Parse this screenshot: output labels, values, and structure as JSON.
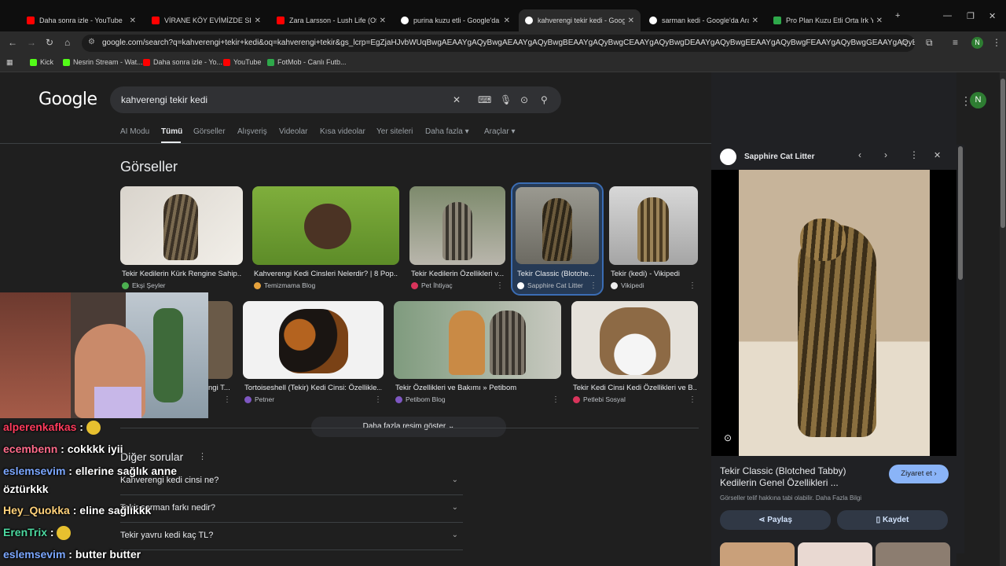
{
  "tabs": [
    {
      "label": "Daha sonra izle - YouTube",
      "color": "#ff0000"
    },
    {
      "label": "VİRANE KÖY EVİMİZDE SIRADIŞI",
      "color": "#ff0000"
    },
    {
      "label": "Zara Larsson - Lush Life (Offici",
      "color": "#ff0000"
    },
    {
      "label": "purina kuzu etli - Google'da Ar",
      "color": "#ffffff"
    },
    {
      "label": "kahverengi tekir kedi - Google'",
      "color": "#ffffff"
    },
    {
      "label": "sarman kedi - Google'da Ara",
      "color": "#ffffff"
    },
    {
      "label": "Pro Plan Kuzu Etli Orta Irk Yetiş",
      "color": "#2ea84a"
    }
  ],
  "url": "google.com/search?q=kahverengi+tekir+kedi&oq=kahverengi+tekir&gs_lcrp=EgZjaHJvbWUqBwgAEAAYgAQyBwgAEAAYgAQyBwgBEAAYgAQyBwgCEAAYgAQyBwgDEAAYgAQyBwgEEAAYgAQyBwgFEAAYgAQyBwgGEAAYgAQyBwgHEAAYgAQyB...",
  "bookmarks": [
    {
      "label": "Kick",
      "color": "#53fc18"
    },
    {
      "label": "Nesrin Stream - Wat...",
      "color": "#53fc18"
    },
    {
      "label": "Daha sonra izle - Yo...",
      "color": "#ff0000"
    },
    {
      "label": "YouTube",
      "color": "#ff0000"
    },
    {
      "label": "FotMob - Canlı Futb...",
      "color": "#2ea84a"
    }
  ],
  "logo": "Google",
  "search": {
    "query": "kahverengi tekir kedi"
  },
  "gtabs": [
    "AI Modu",
    "Tümü",
    "Görseller",
    "Alışveriş",
    "Videolar",
    "Kısa videolar",
    "Yer siteleri",
    "Daha fazla ▾",
    "Araçlar ▾"
  ],
  "images_heading": "Görseller",
  "images_row1": [
    {
      "caption": "Tekir Kedilerin Kürk Rengine Sahip...",
      "source": "Ekşi Şeyler"
    },
    {
      "caption": "Kahverengi Kedi Cinsleri Nelerdir? | 8 Pop...",
      "source": "Temizmama Blog"
    },
    {
      "caption": "Tekir Kedilerin Özellikleri v...",
      "source": "Pet İhtiyaç"
    },
    {
      "caption": "Tekir Classic (Blotche...",
      "source": "Sapphire Cat Litter"
    },
    {
      "caption": "Tekir (kedi) - Vikipedi",
      "source": "Vikipedi"
    }
  ],
  "images_row2": [
    {
      "caption": "ngi T...",
      "source": ""
    },
    {
      "caption": "Tortoiseshell (Tekir) Kedi Cinsi: Özellikle...",
      "source": "Petner"
    },
    {
      "caption": "Tekir Özellikleri ve Bakımı » Petibom",
      "source": "Petibom Blog"
    },
    {
      "caption": "Tekir Kedi Cinsi Kedi Özellikleri ve B...",
      "source": "Petlebi Sosyal"
    }
  ],
  "more_images": "Daha fazla resim göster ⌄",
  "questions_heading": "Diğer sorular",
  "questions": [
    "Kahverengi kedi cinsi ne?",
    "Tekir sarman farkı nedir?",
    "Tekir yavru kedi kaç TL?"
  ],
  "panel": {
    "source": "Sapphire Cat Litter",
    "title": "Tekir Classic (Blotched Tabby) Kedilerin Genel Özellikleri ...",
    "visit": "Ziyaret et ›",
    "note": "Görseller telif hakkına tabi olabilir. Daha Fazla Bilgi",
    "share": "Paylaş",
    "save": "Kaydet"
  },
  "chat": [
    {
      "user": "alperenkafkas",
      "color": "#ff3b5c",
      "text": "",
      "emoji": true
    },
    {
      "user": "ecembenn",
      "color": "#ff6b8a",
      "text": "cokkkk iyii",
      "emoji": false
    },
    {
      "user": "eslemsevim",
      "color": "#7ba7ff",
      "text": "ellerine sağlık anne",
      "emoji": false
    },
    {
      "user": "",
      "color": "#ffffff",
      "text": "öztürkkk",
      "emoji": false
    },
    {
      "user": "Hey_Quokka",
      "color": "#ffd27a",
      "text": "eline sağlıkkk",
      "emoji": false
    },
    {
      "user": "ErenTrix",
      "color": "#4cd9a0",
      "text": "",
      "emoji": true
    },
    {
      "user": "eslemsevim",
      "color": "#7ba7ff",
      "text": "butter butter",
      "emoji": false
    }
  ],
  "avatar": "N"
}
